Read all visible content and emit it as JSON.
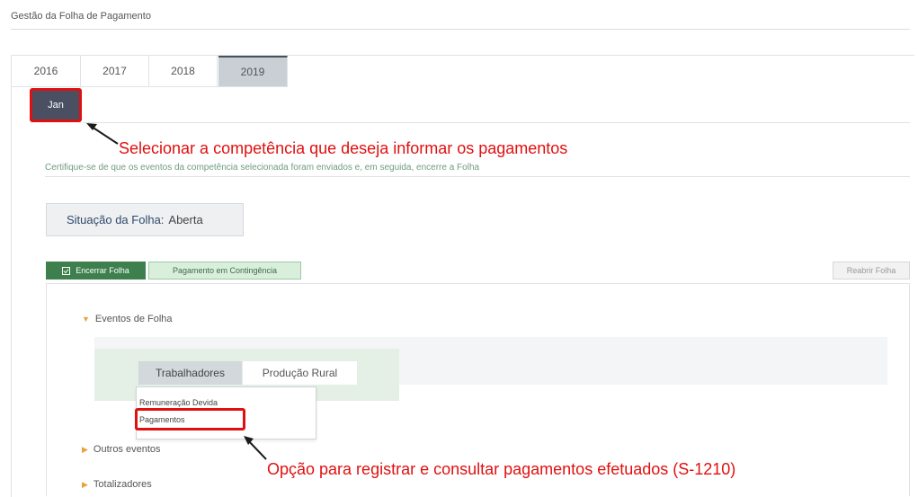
{
  "page": {
    "title": "Gestão da Folha de Pagamento"
  },
  "year_tabs": [
    {
      "label": "2016",
      "active": false
    },
    {
      "label": "2017",
      "active": false
    },
    {
      "label": "2018",
      "active": false
    },
    {
      "label": "2019",
      "active": true
    }
  ],
  "month": {
    "label": "Jan"
  },
  "annotations": {
    "select_month": "Selecionar a competência que deseja informar os pagamentos",
    "payments_option": "Opção para registrar e consultar pagamentos efetuados (S-1210)"
  },
  "info_text": "Certifique-se de que os eventos da competência selecionada foram enviados e, em seguida, encerre a Folha",
  "status": {
    "label": "Situação da Folha:",
    "value": "Aberta"
  },
  "actions": {
    "close_payroll": "Encerrar Folha",
    "contingency_payment": "Pagamento em Contingência",
    "reopen_payroll": "Reabrir Folha"
  },
  "sections": {
    "payroll_events": "Eventos de Folha",
    "other_events": "Outros eventos",
    "totalizers": "Totalizadores"
  },
  "subtabs": {
    "workers": "Trabalhadores",
    "rural_production": "Produção Rural"
  },
  "dropdown": {
    "items": [
      "Remuneração Devida",
      "Pagamentos"
    ]
  },
  "colors": {
    "accent_green": "#3d7f4d",
    "annotation_red": "#e01010",
    "tab_dark": "#4a5062"
  }
}
